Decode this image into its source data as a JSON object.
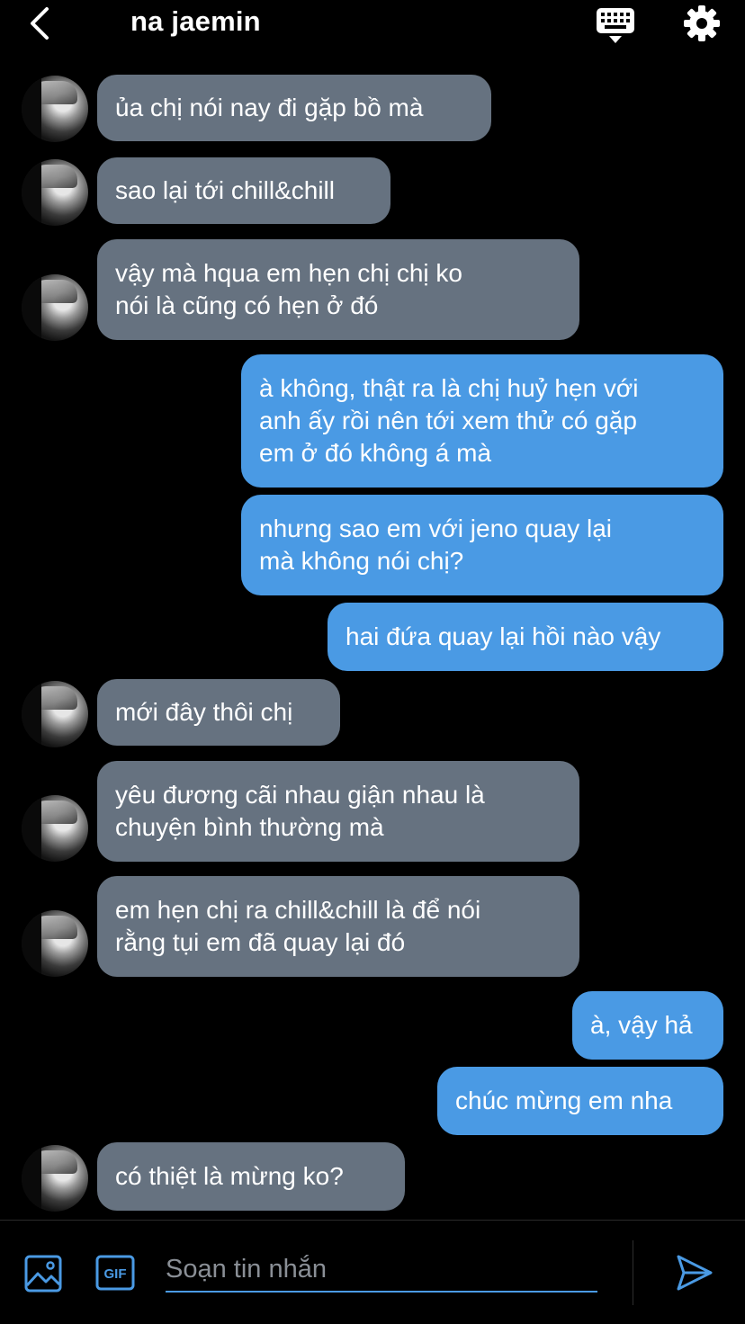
{
  "header": {
    "title": "na jaemin",
    "back_icon": "chevron-left-icon",
    "keyboard_icon": "keyboard-icon",
    "settings_icon": "gear-icon"
  },
  "colors": {
    "background": "#000000",
    "incoming_bubble": "#667280",
    "outgoing_bubble": "#4a9ae4",
    "text": "#ffffff",
    "placeholder": "#8a8f96"
  },
  "messages": [
    {
      "direction": "in",
      "text": "ủa chị nói nay đi gặp bồ mà"
    },
    {
      "direction": "in",
      "text": "sao lại tới chill&chill"
    },
    {
      "direction": "in",
      "text": "vậy mà hqua em hẹn chị chị ko\nnói là cũng có hẹn ở đó"
    },
    {
      "direction": "out",
      "text": "à không, thật ra là chị huỷ hẹn với\nanh ấy rồi nên tới xem thử có gặp\nem ở đó không á mà"
    },
    {
      "direction": "out",
      "text": "nhưng sao em với jeno quay lại\nmà không nói chị?"
    },
    {
      "direction": "out",
      "text": "hai đứa quay lại hồi nào vậy"
    },
    {
      "direction": "in",
      "text": "mới đây thôi chị"
    },
    {
      "direction": "in",
      "text": "yêu đương cãi nhau giận nhau là\nchuyện bình thường mà"
    },
    {
      "direction": "in",
      "text": "em hẹn chị ra chill&chill là để nói\nrằng tụi em đã quay lại đó"
    },
    {
      "direction": "out",
      "text": "à, vậy hả"
    },
    {
      "direction": "out",
      "text": "chúc mừng em nha"
    },
    {
      "direction": "in",
      "text": "có thiệt là mừng ko?"
    }
  ],
  "composer": {
    "placeholder": "Soạn tin nhắn",
    "value": "",
    "image_icon": "image-icon",
    "gif_icon": "gif-icon",
    "gif_label": "GIF",
    "send_icon": "send-icon"
  }
}
